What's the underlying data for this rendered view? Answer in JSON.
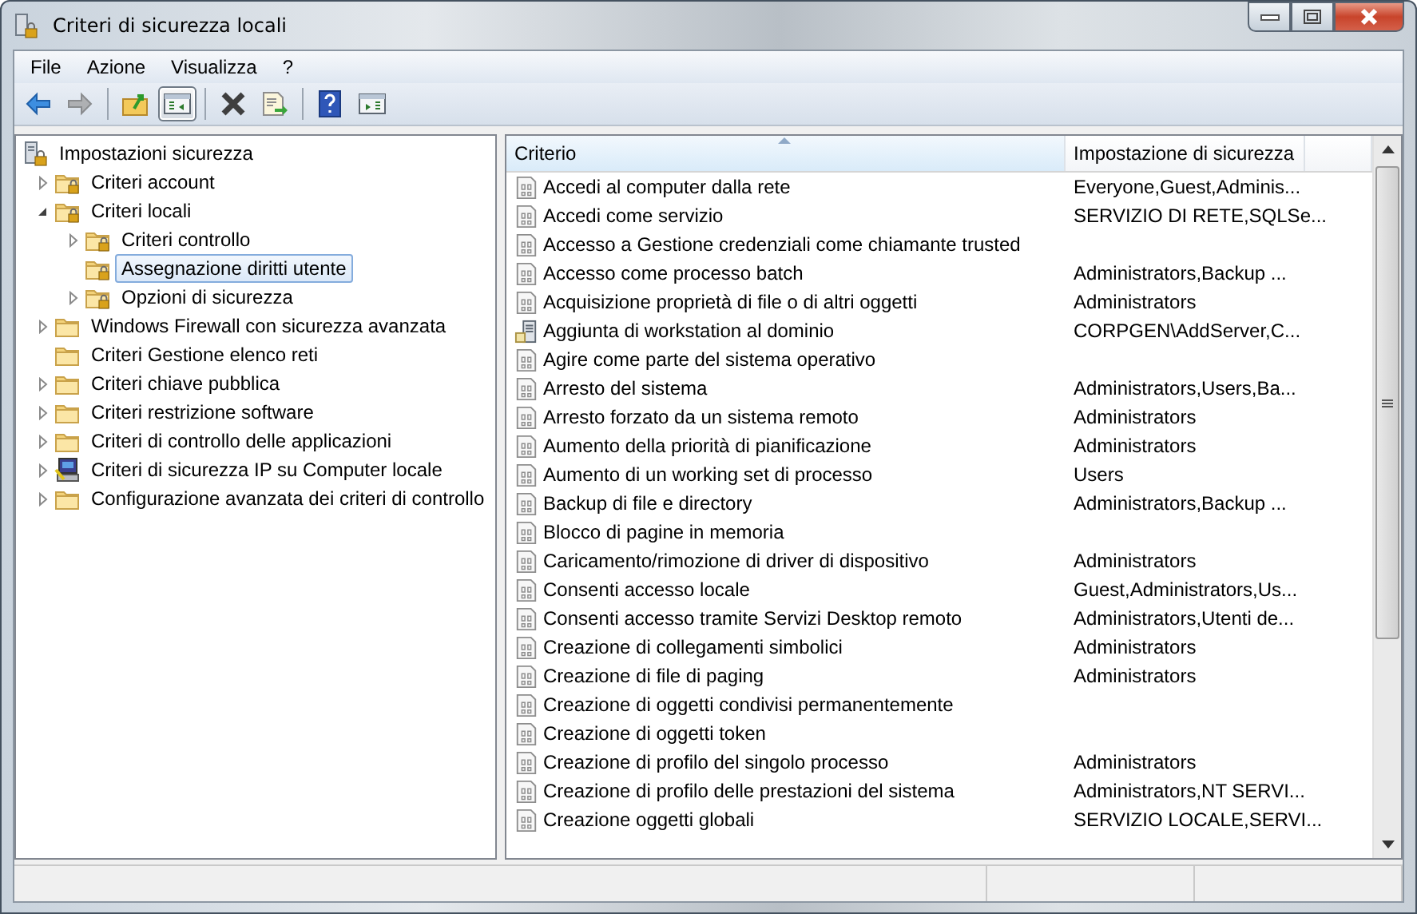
{
  "window": {
    "title": "Criteri di sicurezza locali"
  },
  "menu": [
    "File",
    "Azione",
    "Visualizza",
    "?"
  ],
  "toolbar": [
    {
      "kind": "back",
      "pressed": false,
      "disabled": false
    },
    {
      "kind": "forward",
      "pressed": false,
      "disabled": true
    },
    {
      "kind": "separator"
    },
    {
      "kind": "up",
      "pressed": false,
      "disabled": false
    },
    {
      "kind": "tree",
      "pressed": true,
      "disabled": false
    },
    {
      "kind": "separator"
    },
    {
      "kind": "delete",
      "pressed": false,
      "disabled": false
    },
    {
      "kind": "export",
      "pressed": false,
      "disabled": false
    },
    {
      "kind": "separator"
    },
    {
      "kind": "help",
      "pressed": false,
      "disabled": false
    },
    {
      "kind": "pane",
      "pressed": false,
      "disabled": false
    }
  ],
  "tree": {
    "label": "Impostazioni sicurezza",
    "kind": "server",
    "selected": false,
    "children": [
      {
        "label": "Criteri account",
        "kind": "lock-folder",
        "expanded": false,
        "selected": false
      },
      {
        "label": "Criteri locali",
        "kind": "lock-folder",
        "expanded": true,
        "selected": false,
        "children": [
          {
            "label": "Criteri controllo",
            "kind": "lock-folder",
            "expanded": false,
            "selected": false
          },
          {
            "label": "Assegnazione diritti utente",
            "kind": "lock-folder",
            "selected": true
          },
          {
            "label": "Opzioni di sicurezza",
            "kind": "lock-folder",
            "expanded": false,
            "selected": false
          }
        ]
      },
      {
        "label": "Windows Firewall con sicurezza avanzata",
        "kind": "folder",
        "expanded": false,
        "selected": false
      },
      {
        "label": "Criteri Gestione elenco reti",
        "kind": "folder",
        "selected": false
      },
      {
        "label": "Criteri chiave pubblica",
        "kind": "folder",
        "expanded": false,
        "selected": false
      },
      {
        "label": "Criteri restrizione software",
        "kind": "folder",
        "expanded": false,
        "selected": false
      },
      {
        "label": "Criteri di controllo delle applicazioni",
        "kind": "folder",
        "expanded": false,
        "selected": false
      },
      {
        "label": "Criteri di sicurezza IP su Computer locale",
        "kind": "computer",
        "expanded": false,
        "selected": false
      },
      {
        "label": "Configurazione avanzata dei criteri di controllo",
        "kind": "folder",
        "expanded": false,
        "selected": false
      }
    ]
  },
  "table": {
    "columns": [
      {
        "label": "Criterio",
        "sorted": true
      },
      {
        "label": "Impostazione di sicurezza",
        "sorted": false
      }
    ],
    "rows": [
      {
        "kind": "policy",
        "policy": "Accedi al computer dalla rete",
        "setting": "Everyone,Guest,Adminis..."
      },
      {
        "kind": "policy",
        "policy": "Accedi come servizio",
        "setting": "SERVIZIO DI RETE,SQLSe..."
      },
      {
        "kind": "policy",
        "policy": "Accesso a Gestione credenziali come chiamante trusted"
      },
      {
        "kind": "policy",
        "policy": "Accesso come processo batch",
        "setting": "Administrators,Backup ..."
      },
      {
        "kind": "policy",
        "policy": "Acquisizione proprietà di file o di altri oggetti",
        "setting": "Administrators"
      },
      {
        "kind": "workstation",
        "policy": "Aggiunta di workstation al dominio",
        "setting": "CORPGEN\\AddServer,C..."
      },
      {
        "kind": "policy",
        "policy": "Agire come parte del sistema operativo"
      },
      {
        "kind": "policy",
        "policy": "Arresto del sistema",
        "setting": "Administrators,Users,Ba..."
      },
      {
        "kind": "policy",
        "policy": "Arresto forzato da un sistema remoto",
        "setting": "Administrators"
      },
      {
        "kind": "policy",
        "policy": "Aumento della priorità di pianificazione",
        "setting": "Administrators"
      },
      {
        "kind": "policy",
        "policy": "Aumento di un working set di processo",
        "setting": "Users"
      },
      {
        "kind": "policy",
        "policy": "Backup di file e directory",
        "setting": "Administrators,Backup ..."
      },
      {
        "kind": "policy",
        "policy": "Blocco di pagine in memoria"
      },
      {
        "kind": "policy",
        "policy": "Caricamento/rimozione di driver di dispositivo",
        "setting": "Administrators"
      },
      {
        "kind": "policy",
        "policy": "Consenti accesso locale",
        "setting": "Guest,Administrators,Us..."
      },
      {
        "kind": "policy",
        "policy": "Consenti accesso tramite Servizi Desktop remoto",
        "setting": "Administrators,Utenti de..."
      },
      {
        "kind": "policy",
        "policy": "Creazione di collegamenti simbolici",
        "setting": "Administrators"
      },
      {
        "kind": "policy",
        "policy": "Creazione di file di paging",
        "setting": "Administrators"
      },
      {
        "kind": "policy",
        "policy": "Creazione di oggetti condivisi permanentemente"
      },
      {
        "kind": "policy",
        "policy": "Creazione di oggetti token"
      },
      {
        "kind": "policy",
        "policy": "Creazione di profilo del singolo processo",
        "setting": "Administrators"
      },
      {
        "kind": "policy",
        "policy": "Creazione di profilo delle prestazioni del sistema",
        "setting": "Administrators,NT SERVI..."
      },
      {
        "kind": "policy",
        "policy": "Creazione oggetti globali",
        "setting": "SERVIZIO LOCALE,SERVI..."
      }
    ]
  }
}
